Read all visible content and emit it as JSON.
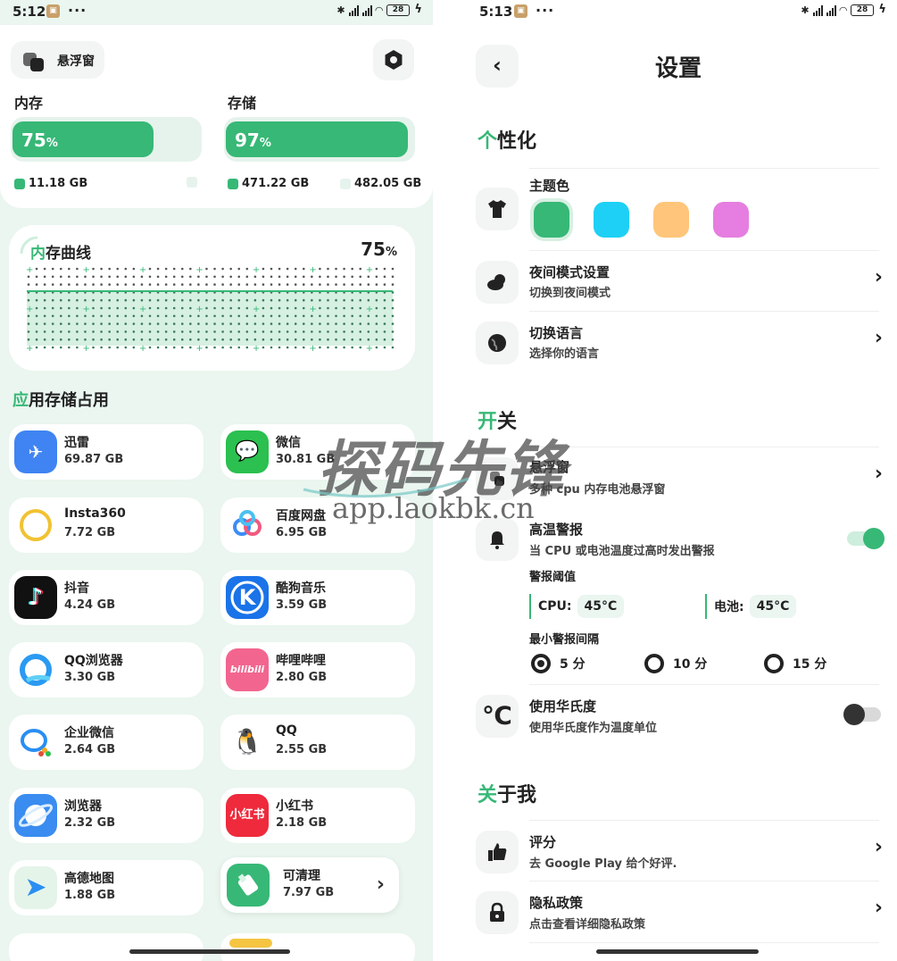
{
  "left": {
    "status": {
      "time": "5:12",
      "dots": "···",
      "battery": "28"
    },
    "floating_window_label": "悬浮窗",
    "memory": {
      "label": "内存",
      "percent": 75,
      "percent_text": "75",
      "used": "11.18 GB"
    },
    "storage": {
      "label": "存储",
      "percent": 97,
      "percent_text": "97",
      "used": "471.22 GB",
      "total": "482.05 GB"
    },
    "percent_sign": "%",
    "curve": {
      "title_accent": "内",
      "title_rest": "存曲线",
      "value_text": "75"
    },
    "apps_title_accent": "应",
    "apps_title_rest": "用存储占用",
    "apps": [
      {
        "name": "迅雷",
        "size": "69.87 GB",
        "icon": "xunlei-icon",
        "color": "#3f84f2"
      },
      {
        "name": "微信",
        "size": "30.81 GB",
        "icon": "wechat-icon",
        "color": "#2bc04f"
      },
      {
        "name": "Insta360",
        "size": "7.72 GB",
        "icon": "insta360-icon",
        "color": "#ffffff"
      },
      {
        "name": "百度网盘",
        "size": "6.95 GB",
        "icon": "baidu-netdisk-icon",
        "color": "#ffffff"
      },
      {
        "name": "抖音",
        "size": "4.24 GB",
        "icon": "douyin-icon",
        "color": "#111111"
      },
      {
        "name": "酷狗音乐",
        "size": "3.59 GB",
        "icon": "kugou-icon",
        "color": "#1a73e8"
      },
      {
        "name": "QQ浏览器",
        "size": "3.30 GB",
        "icon": "qq-browser-icon",
        "color": "#ffffff"
      },
      {
        "name": "哔哩哔哩",
        "size": "2.80 GB",
        "icon": "bilibili-icon",
        "color": "#f2658f"
      },
      {
        "name": "企业微信",
        "size": "2.64 GB",
        "icon": "wecom-icon",
        "color": "#ffffff"
      },
      {
        "name": "QQ",
        "size": "2.55 GB",
        "icon": "qq-icon",
        "color": "#ffffff"
      },
      {
        "name": "浏览器",
        "size": "2.32 GB",
        "icon": "browser-icon",
        "color": "#3a8cf0"
      },
      {
        "name": "小红书",
        "size": "2.18 GB",
        "icon": "xiaohongshu-icon",
        "color": "#ee2a3c"
      },
      {
        "name": "高德地图",
        "size": "1.88 GB",
        "icon": "amap-icon",
        "color": "#ffffff"
      }
    ],
    "clean": {
      "name": "可清理",
      "size": "7.97 GB",
      "arrow": "›"
    },
    "icon_glyphs": {
      "xunlei": "✈",
      "wechat": "💬",
      "douyin": "♪",
      "kugou": "K",
      "bilibili": "bilibili",
      "qq": "🐧",
      "xiaohongshu": "小红书",
      "amap": "➤"
    }
  },
  "right": {
    "status": {
      "time": "5:13",
      "dots": "···",
      "battery": "28"
    },
    "back": "‹",
    "title": "设置",
    "sections": {
      "personal": {
        "accent": "个",
        "rest": "性化"
      },
      "switch": {
        "accent": "开",
        "rest": "关"
      },
      "about": {
        "accent": "关",
        "rest": "于我"
      }
    },
    "theme": {
      "label": "主题色",
      "colors": [
        "#37b876",
        "#1ed0f5",
        "#ffc57a",
        "#e57ee0"
      ]
    },
    "night": {
      "label": "夜间模式设置",
      "sub": "切换到夜间模式"
    },
    "language": {
      "label": "切换语言",
      "sub": "选择你的语言"
    },
    "floating": {
      "label": "悬浮窗",
      "sub": "多种 cpu 内存电池悬浮窗"
    },
    "temp_alert": {
      "label": "高温警报",
      "sub": "当 CPU 或电池温度过高时发出警报",
      "enabled": true
    },
    "threshold": {
      "label": "警报阈值",
      "cpu_label": "CPU:",
      "cpu_value": "45°C",
      "battery_label": "电池:",
      "battery_value": "45°C"
    },
    "interval": {
      "label": "最小警报间隔",
      "options": [
        "5 分",
        "10 分",
        "15 分"
      ],
      "selected": "5 分"
    },
    "fahrenheit": {
      "label": "使用华氏度",
      "sub": "使用华氏度作为温度单位",
      "enabled": false,
      "glyph": "℃"
    },
    "rate": {
      "label": "评分",
      "sub": "去 Google Play 给个好评."
    },
    "privacy": {
      "label": "隐私政策",
      "sub": "点击查看详细隐私政策"
    },
    "chevron": "›"
  },
  "watermark": {
    "text": "探码先锋",
    "url": "app.laokbk.cn"
  },
  "colors": {
    "accent": "#37b876",
    "track": "#e6f3ec",
    "bg_left": "#eaf6ef"
  }
}
